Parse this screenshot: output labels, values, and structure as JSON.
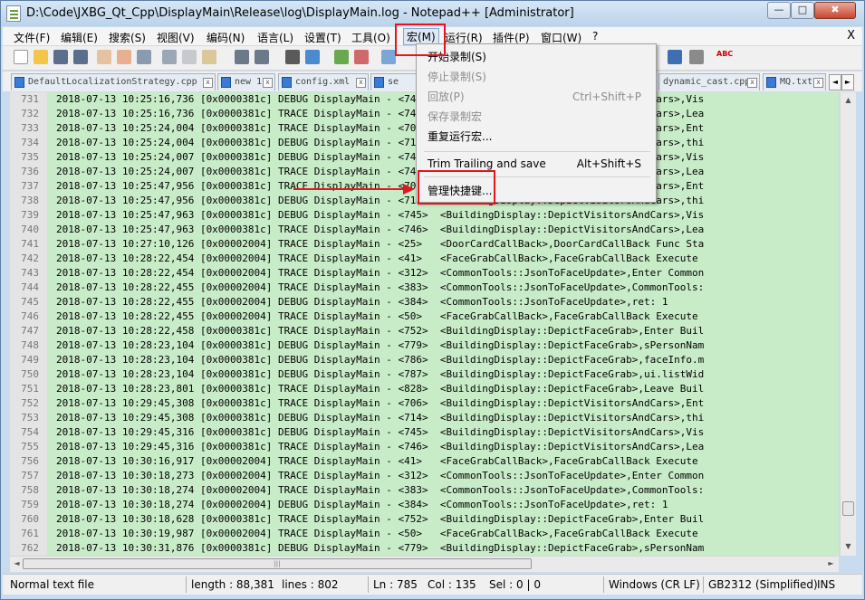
{
  "window": {
    "title": "D:\\Code\\JXBG_Qt_Cpp\\DisplayMain\\Release\\log\\DisplayMain.log - Notepad++ [Administrator]",
    "minimize_glyph": "—",
    "maximize_glyph": "□",
    "close_glyph": "✖"
  },
  "menu": {
    "items": [
      "文件(F)",
      "编辑(E)",
      "搜索(S)",
      "视图(V)",
      "编码(N)",
      "语言(L)",
      "设置(T)",
      "工具(O)",
      "宏(M)",
      "运行(R)",
      "插件(P)",
      "窗口(W)",
      "?"
    ],
    "close": "X",
    "active": "宏(M)"
  },
  "tabs": [
    {
      "label": "DefaultLocalizationStrategy.cpp"
    },
    {
      "label": "new 1"
    },
    {
      "label": "config.xml"
    },
    {
      "label": "se"
    },
    {
      "label": "dynamic_cast.cpp"
    },
    {
      "label": "MQ.txt"
    }
  ],
  "tab_arrows": [
    "◄",
    "►"
  ],
  "editor": {
    "lines": [
      {
        "n": "731",
        "t": "2018-07-13 10:25:16,736 [0x0000381c] DEBUG DisplayMain - <745>  <BuildingDisplay::DepictVisitorsAndCars>,Vis"
      },
      {
        "n": "732",
        "t": "2018-07-13 10:25:16,736 [0x0000381c] TRACE DisplayMain - <746>  <BuildingDisplay::DepictVisitorsAndCars>,Lea"
      },
      {
        "n": "733",
        "t": "2018-07-13 10:25:24,004 [0x0000381c] TRACE DisplayMain - <706>  <BuildingDisplay::DepictVisitorsAndCars>,Ent"
      },
      {
        "n": "734",
        "t": "2018-07-13 10:25:24,004 [0x0000381c] DEBUG DisplayMain - <714>  <BuildingDisplay::DepictVisitorsAndCars>,thi"
      },
      {
        "n": "735",
        "t": "2018-07-13 10:25:24,007 [0x0000381c] DEBUG DisplayMain - <745>  <BuildingDisplay::DepictVisitorsAndCars>,Vis"
      },
      {
        "n": "736",
        "t": "2018-07-13 10:25:24,007 [0x0000381c] TRACE DisplayMain - <746>  <BuildingDisplay::DepictVisitorsAndCars>,Lea"
      },
      {
        "n": "737",
        "t": "2018-07-13 10:25:47,956 [0x0000381c] TRACE DisplayMain - <706>  <BuildingDisplay::DepictVisitorsAndCars>,Ent"
      },
      {
        "n": "738",
        "t": "2018-07-13 10:25:47,956 [0x0000381c] DEBUG DisplayMain - <714>  <BuildingDisplay::DepictVisitorsAndCars>,thi"
      },
      {
        "n": "739",
        "t": "2018-07-13 10:25:47,963 [0x0000381c] DEBUG DisplayMain - <745>  <BuildingDisplay::DepictVisitorsAndCars>,Vis"
      },
      {
        "n": "740",
        "t": "2018-07-13 10:25:47,963 [0x0000381c] TRACE DisplayMain - <746>  <BuildingDisplay::DepictVisitorsAndCars>,Lea"
      },
      {
        "n": "741",
        "t": "2018-07-13 10:27:10,126 [0x00002004] TRACE DisplayMain - <25>   <DoorCardCallBack>,DoorCardCallBack Func Sta"
      },
      {
        "n": "742",
        "t": "2018-07-13 10:28:22,454 [0x00002004] TRACE DisplayMain - <41>   <FaceGrabCallBack>,FaceGrabCallBack Execute"
      },
      {
        "n": "743",
        "t": "2018-07-13 10:28:22,454 [0x00002004] TRACE DisplayMain - <312>  <CommonTools::JsonToFaceUpdate>,Enter Common"
      },
      {
        "n": "744",
        "t": "2018-07-13 10:28:22,455 [0x00002004] TRACE DisplayMain - <383>  <CommonTools::JsonToFaceUpdate>,CommonTools:"
      },
      {
        "n": "745",
        "t": "2018-07-13 10:28:22,455 [0x00002004] DEBUG DisplayMain - <384>  <CommonTools::JsonToFaceUpdate>,ret: 1"
      },
      {
        "n": "746",
        "t": "2018-07-13 10:28:22,455 [0x00002004] TRACE DisplayMain - <50>   <FaceGrabCallBack>,FaceGrabCallBack Execute"
      },
      {
        "n": "747",
        "t": "2018-07-13 10:28:22,458 [0x0000381c] TRACE DisplayMain - <752>  <BuildingDisplay::DepictFaceGrab>,Enter Buil"
      },
      {
        "n": "748",
        "t": "2018-07-13 10:28:23,104 [0x0000381c] DEBUG DisplayMain - <779>  <BuildingDisplay::DepictFaceGrab>,sPersonNam"
      },
      {
        "n": "749",
        "t": "2018-07-13 10:28:23,104 [0x0000381c] DEBUG DisplayMain - <786>  <BuildingDisplay::DepictFaceGrab>,faceInfo.m"
      },
      {
        "n": "750",
        "t": "2018-07-13 10:28:23,104 [0x0000381c] DEBUG DisplayMain - <787>  <BuildingDisplay::DepictFaceGrab>,ui.listWid"
      },
      {
        "n": "751",
        "t": "2018-07-13 10:28:23,801 [0x0000381c] TRACE DisplayMain - <828>  <BuildingDisplay::DepictFaceGrab>,Leave Buil"
      },
      {
        "n": "752",
        "t": "2018-07-13 10:29:45,308 [0x0000381c] TRACE DisplayMain - <706>  <BuildingDisplay::DepictVisitorsAndCars>,Ent"
      },
      {
        "n": "753",
        "t": "2018-07-13 10:29:45,308 [0x0000381c] DEBUG DisplayMain - <714>  <BuildingDisplay::DepictVisitorsAndCars>,thi"
      },
      {
        "n": "754",
        "t": "2018-07-13 10:29:45,316 [0x0000381c] DEBUG DisplayMain - <745>  <BuildingDisplay::DepictVisitorsAndCars>,Vis"
      },
      {
        "n": "755",
        "t": "2018-07-13 10:29:45,316 [0x0000381c] TRACE DisplayMain - <746>  <BuildingDisplay::DepictVisitorsAndCars>,Lea"
      },
      {
        "n": "756",
        "t": "2018-07-13 10:30:16,917 [0x00002004] TRACE DisplayMain - <41>   <FaceGrabCallBack>,FaceGrabCallBack Execute"
      },
      {
        "n": "757",
        "t": "2018-07-13 10:30:18,273 [0x00002004] TRACE DisplayMain - <312>  <CommonTools::JsonToFaceUpdate>,Enter Common"
      },
      {
        "n": "758",
        "t": "2018-07-13 10:30:18,274 [0x00002004] TRACE DisplayMain - <383>  <CommonTools::JsonToFaceUpdate>,CommonTools:"
      },
      {
        "n": "759",
        "t": "2018-07-13 10:30:18,274 [0x00002004] DEBUG DisplayMain - <384>  <CommonTools::JsonToFaceUpdate>,ret: 1"
      },
      {
        "n": "760",
        "t": "2018-07-13 10:30:18,628 [0x0000381c] TRACE DisplayMain - <752>  <BuildingDisplay::DepictFaceGrab>,Enter Buil"
      },
      {
        "n": "761",
        "t": "2018-07-13 10:30:19,987 [0x00002004] TRACE DisplayMain - <50>   <FaceGrabCallBack>,FaceGrabCallBack Execute"
      },
      {
        "n": "762",
        "t": "2018-07-13 10:30:31,876 [0x0000381c] DEBUG DisplayMain - <779>  <BuildingDisplay::DepictFaceGrab>,sPersonNam"
      }
    ]
  },
  "scrollbar": {
    "up": "▲",
    "down": "▼",
    "left": "◄",
    "right": "►",
    "grip": "|||"
  },
  "macro_menu": {
    "items": [
      {
        "label": "开始录制(S)",
        "shortcut": "",
        "enabled": true
      },
      {
        "label": "停止录制(S)",
        "shortcut": "",
        "enabled": false
      },
      {
        "label": "回放(P)",
        "shortcut": "Ctrl+Shift+P",
        "enabled": false
      },
      {
        "label": "保存录制宏",
        "shortcut": "",
        "enabled": false
      },
      {
        "label": "重复运行宏...",
        "shortcut": "",
        "enabled": true
      },
      {
        "label": "Trim Trailing and save",
        "shortcut": "Alt+Shift+S",
        "enabled": true
      },
      {
        "label": "管理快捷键...",
        "shortcut": "",
        "enabled": true
      }
    ]
  },
  "status": {
    "file_type": "Normal text file",
    "length": "length : 88,381",
    "lines": "lines : 802",
    "ln": "Ln : 785",
    "col": "Col : 135",
    "sel": "Sel : 0 | 0",
    "eol": "Windows (CR LF)",
    "encoding": "GB2312 (Simplified)",
    "mode": "INS"
  },
  "colors": {
    "editor_bg": "#c9ecc8",
    "highlight": "#e0171d",
    "chrome_bg": "#c9dcef"
  }
}
